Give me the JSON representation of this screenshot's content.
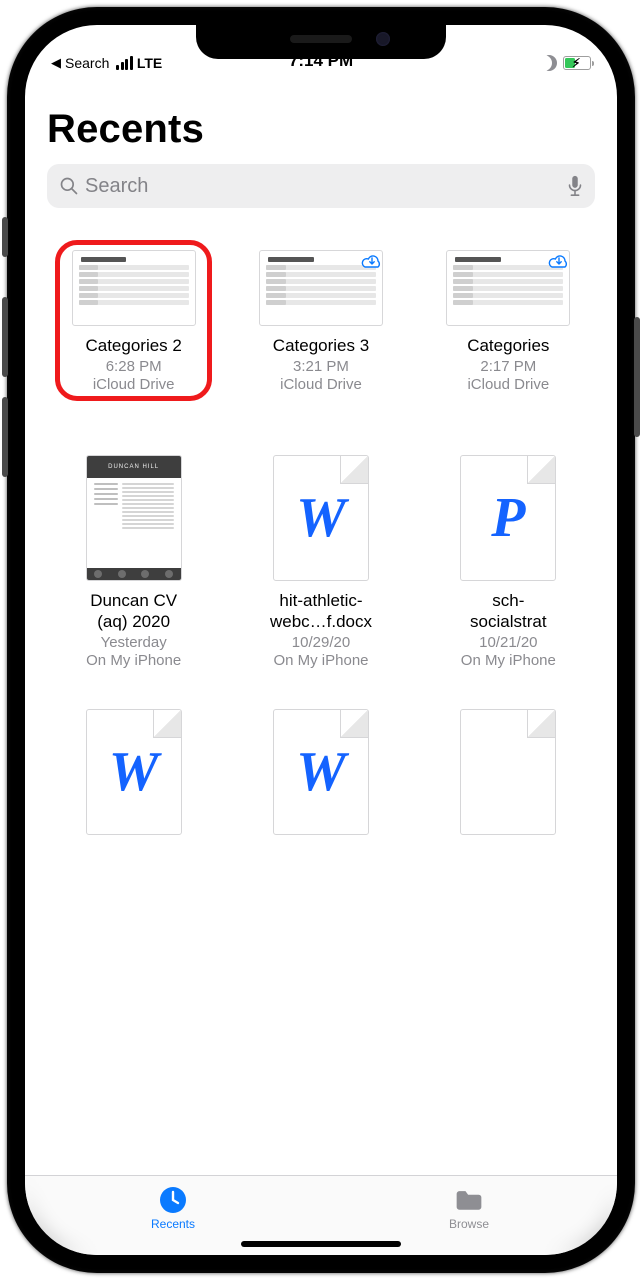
{
  "status": {
    "back_label": "Search",
    "carrier": "LTE",
    "time": "7:14 PM"
  },
  "header": {
    "title": "Recents"
  },
  "search": {
    "placeholder": "Search"
  },
  "files": [
    {
      "name": "Categories 2",
      "time": "6:28 PM",
      "location": "iCloud Drive"
    },
    {
      "name": "Categories 3",
      "time": "3:21 PM",
      "location": "iCloud Drive"
    },
    {
      "name": "Categories",
      "time": "2:17 PM",
      "location": "iCloud Drive"
    },
    {
      "name": "Duncan CV\n(aq) 2020",
      "time": "Yesterday",
      "location": "On My iPhone"
    },
    {
      "name": "hit-athletic-\nwebc…f.docx",
      "time": "10/29/20",
      "location": "On My iPhone"
    },
    {
      "name": "sch-\nsocialstrat",
      "time": "10/21/20",
      "location": "On My iPhone"
    }
  ],
  "tabs": {
    "recents": "Recents",
    "browse": "Browse"
  },
  "letters": {
    "W": "W",
    "P": "P"
  }
}
